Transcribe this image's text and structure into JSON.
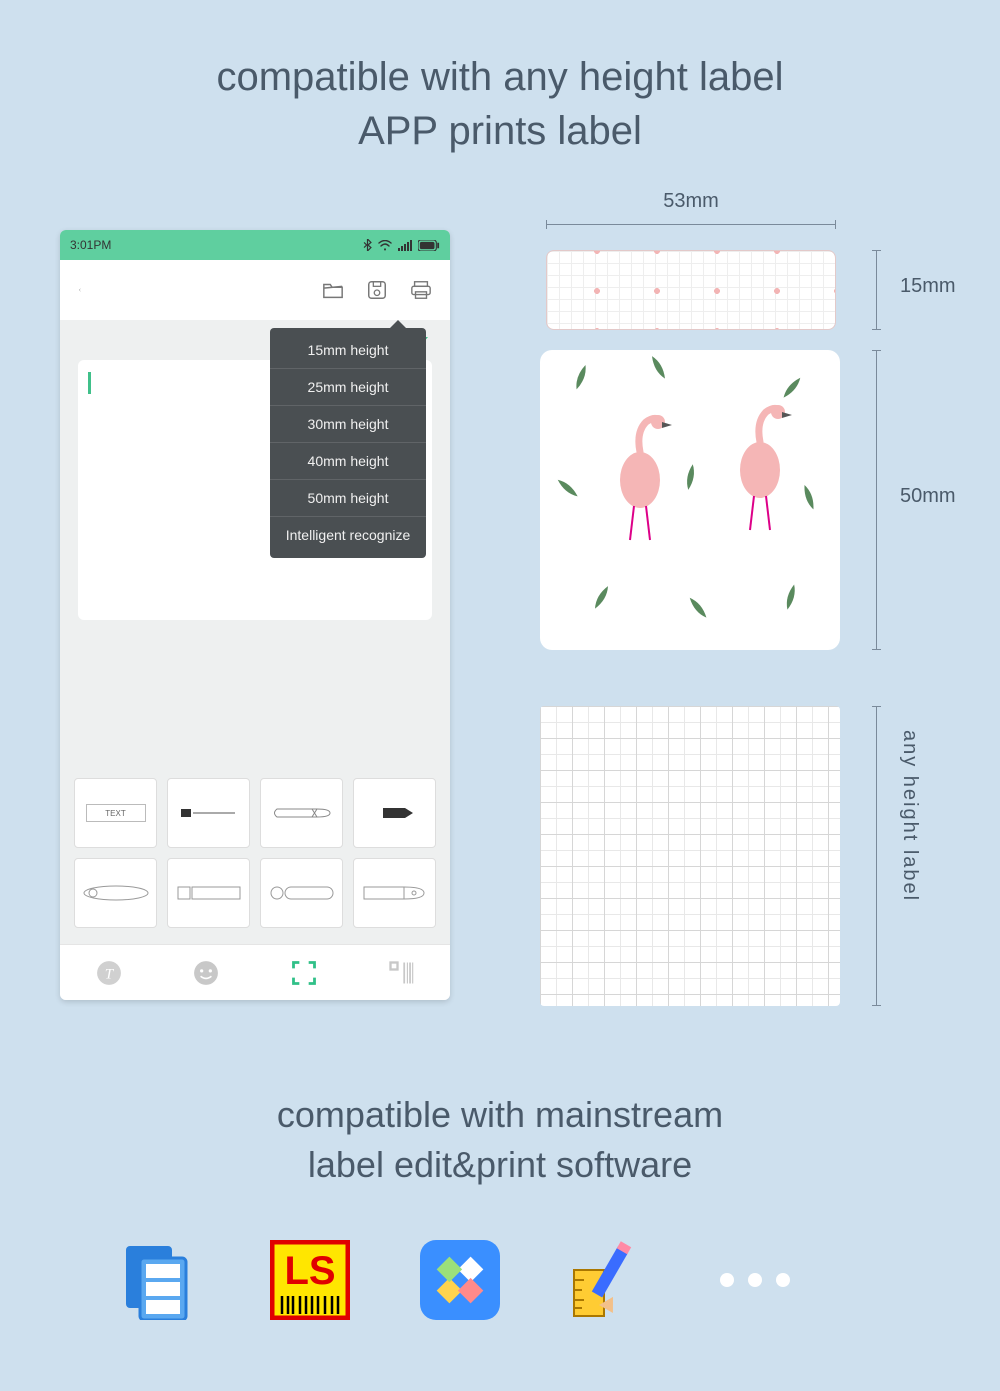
{
  "header": {
    "line1": "compatible with any height label",
    "line2": "APP prints label"
  },
  "phone": {
    "statusbar": {
      "time": "3:01PM"
    },
    "height_select": {
      "current": "25mm height"
    },
    "dropdown": {
      "opt1": "15mm height",
      "opt2": "25mm height",
      "opt3": "30mm height",
      "opt4": "40mm height",
      "opt5": "50mm height",
      "opt6": "Intelligent\nrecognize"
    },
    "templates": {
      "t1": "TEXT"
    }
  },
  "dimensions": {
    "width": "53mm",
    "h15": "15mm",
    "h50": "50mm",
    "any": "any height label"
  },
  "subheader": {
    "line1": "compatible with mainstream",
    "line2": "label edit&print software"
  }
}
